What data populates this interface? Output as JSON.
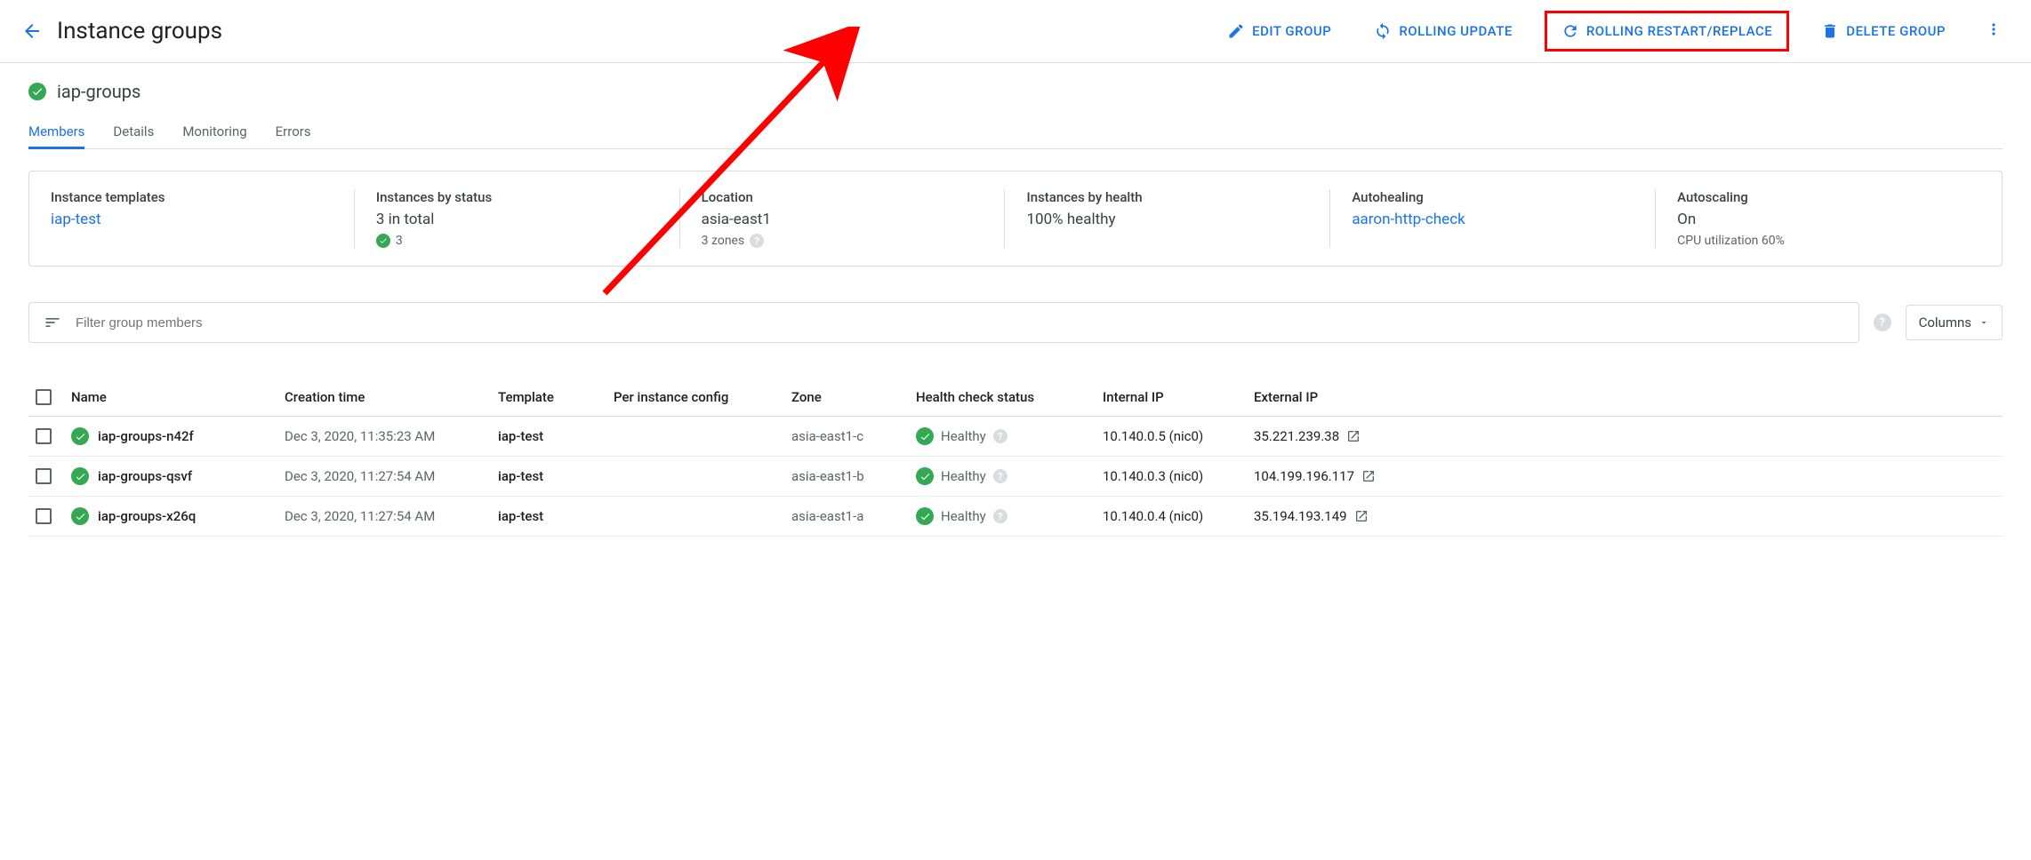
{
  "header": {
    "title": "Instance groups",
    "actions": {
      "edit": "EDIT GROUP",
      "update": "ROLLING UPDATE",
      "restart": "ROLLING RESTART/REPLACE",
      "delete": "DELETE GROUP"
    }
  },
  "group": {
    "name": "iap-groups"
  },
  "tabs": {
    "members": "Members",
    "details": "Details",
    "monitoring": "Monitoring",
    "errors": "Errors"
  },
  "summary": {
    "templates": {
      "label": "Instance templates",
      "value": "iap-test"
    },
    "status": {
      "label": "Instances by status",
      "value": "3 in total",
      "sub": "3"
    },
    "location": {
      "label": "Location",
      "value": "asia-east1",
      "sub": "3 zones"
    },
    "health": {
      "label": "Instances by health",
      "value": "100% healthy"
    },
    "autohealing": {
      "label": "Autohealing",
      "value": "aaron-http-check"
    },
    "autoscaling": {
      "label": "Autoscaling",
      "value": "On",
      "sub": "CPU utilization 60%"
    }
  },
  "filter": {
    "placeholder": "Filter group members",
    "columns": "Columns"
  },
  "table": {
    "headers": {
      "name": "Name",
      "creation": "Creation time",
      "template": "Template",
      "perinstance": "Per instance config",
      "zone": "Zone",
      "health": "Health check status",
      "internal": "Internal IP",
      "external": "External IP"
    },
    "rows": [
      {
        "name": "iap-groups-n42f",
        "creation": "Dec 3, 2020, 11:35:23 AM",
        "template": "iap-test",
        "perinstance": "",
        "zone": "asia-east1-c",
        "health": "Healthy",
        "internal": "10.140.0.5 (nic0)",
        "external": "35.221.239.38"
      },
      {
        "name": "iap-groups-qsvf",
        "creation": "Dec 3, 2020, 11:27:54 AM",
        "template": "iap-test",
        "perinstance": "",
        "zone": "asia-east1-b",
        "health": "Healthy",
        "internal": "10.140.0.3 (nic0)",
        "external": "104.199.196.117"
      },
      {
        "name": "iap-groups-x26q",
        "creation": "Dec 3, 2020, 11:27:54 AM",
        "template": "iap-test",
        "perinstance": "",
        "zone": "asia-east1-a",
        "health": "Healthy",
        "internal": "10.140.0.4 (nic0)",
        "external": "35.194.193.149"
      }
    ]
  }
}
